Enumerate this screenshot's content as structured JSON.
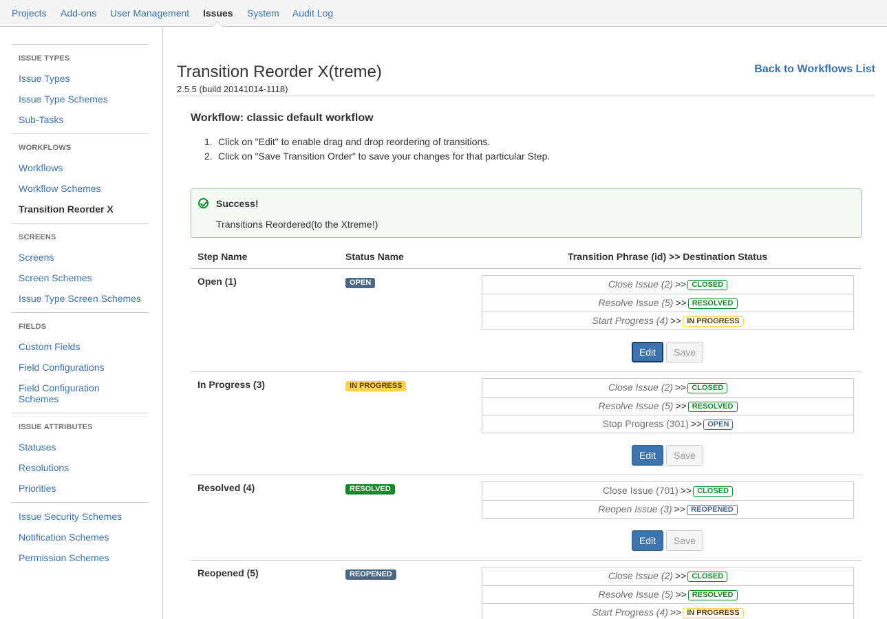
{
  "nav": {
    "tabs": [
      {
        "label": "Projects"
      },
      {
        "label": "Add-ons"
      },
      {
        "label": "User Management"
      },
      {
        "label": "Issues"
      },
      {
        "label": "System"
      },
      {
        "label": "Audit Log"
      }
    ],
    "active": "Issues"
  },
  "sidebar": {
    "sections": [
      {
        "heading": "ISSUE TYPES",
        "items": [
          "Issue Types",
          "Issue Type Schemes",
          "Sub-Tasks"
        ]
      },
      {
        "heading": "WORKFLOWS",
        "items": [
          "Workflows",
          "Workflow Schemes",
          "Transition Reorder X"
        ]
      },
      {
        "heading": "SCREENS",
        "items": [
          "Screens",
          "Screen Schemes",
          "Issue Type Screen Schemes"
        ]
      },
      {
        "heading": "FIELDS",
        "items": [
          "Custom Fields",
          "Field Configurations",
          "Field Configuration Schemes"
        ]
      },
      {
        "heading": "ISSUE ATTRIBUTES",
        "items": [
          "Statuses",
          "Resolutions",
          "Priorities"
        ]
      },
      {
        "heading": "",
        "items": [
          "Issue Security Schemes",
          "Notification Schemes",
          "Permission Schemes"
        ]
      }
    ],
    "active_item": "Transition Reorder X"
  },
  "page": {
    "title": "Transition Reorder X(treme)",
    "version": "2.5.5 (build 20141014-1118)",
    "back_link": "Back to Workflows List",
    "workflow_title": "Workflow: classic default workflow",
    "instructions": [
      "Click on \"Edit\" to enable drag and drop reordering of transitions.",
      "Click on \"Save Transition Order\" to save your changes for that particular Step."
    ]
  },
  "message": {
    "title": "Success!",
    "body": "Transitions Reordered(to the Xtreme!)"
  },
  "table": {
    "headers": {
      "step": "Step Name",
      "status": "Status Name",
      "transitions": "Transition Phrase (id) >> Destination Status"
    },
    "steps": [
      {
        "name": "Open (1)",
        "status": "OPEN",
        "transitions": [
          {
            "phrase": "Close Issue (2)",
            "italic": true,
            "dest": "CLOSED"
          },
          {
            "phrase": "Resolve Issue (5)",
            "italic": true,
            "dest": "RESOLVED"
          },
          {
            "phrase": "Start Progress (4)",
            "italic": true,
            "dest": "IN PROGRESS"
          }
        ]
      },
      {
        "name": "In Progress (3)",
        "status": "IN PROGRESS",
        "transitions": [
          {
            "phrase": "Close Issue (2)",
            "italic": true,
            "dest": "CLOSED"
          },
          {
            "phrase": "Resolve Issue (5)",
            "italic": true,
            "dest": "RESOLVED"
          },
          {
            "phrase": "Stop Progress (301)",
            "italic": false,
            "dest": "OPEN"
          }
        ]
      },
      {
        "name": "Resolved (4)",
        "status": "RESOLVED",
        "transitions": [
          {
            "phrase": "Close Issue (701)",
            "italic": false,
            "dest": "CLOSED"
          },
          {
            "phrase": "Reopen Issue (3)",
            "italic": true,
            "dest": "REOPENED"
          }
        ]
      },
      {
        "name": "Reopened (5)",
        "status": "REOPENED",
        "transitions": [
          {
            "phrase": "Close Issue (2)",
            "italic": true,
            "dest": "CLOSED"
          },
          {
            "phrase": "Resolve Issue (5)",
            "italic": true,
            "dest": "RESOLVED"
          },
          {
            "phrase": "Start Progress (4)",
            "italic": true,
            "dest": "IN PROGRESS"
          }
        ]
      }
    ],
    "arrow": ">>",
    "edit_label": "Edit",
    "save_label": "Save"
  },
  "colors": {
    "link": "#3b73af",
    "success": "#14892c",
    "in_progress": "#ffd351",
    "open_blue": "#4a6785"
  }
}
